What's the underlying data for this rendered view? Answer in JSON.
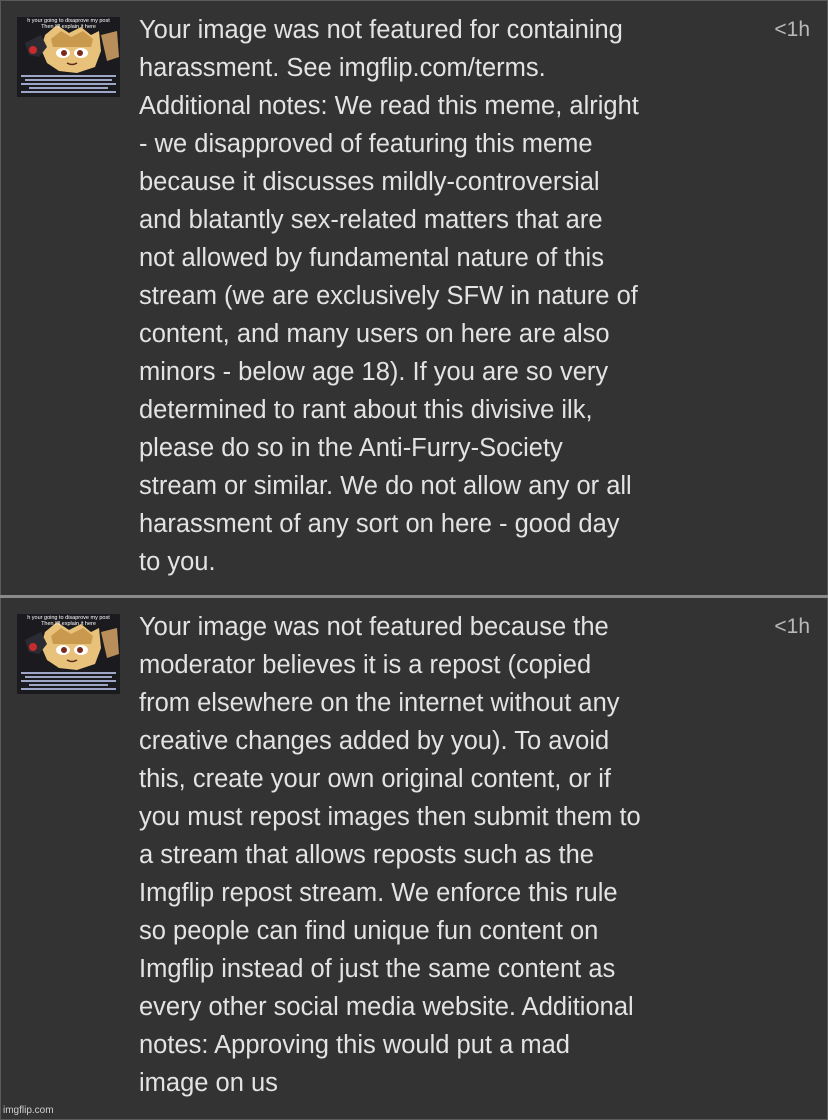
{
  "notifications": [
    {
      "thumbnail": {
        "caption_line_1": "h your going to disaprove my post",
        "caption_line_2": "Then I'll explain it here"
      },
      "message": "Your image was not featured for containing\nharassment. See imgflip.com/terms.\nAdditional notes: We read this meme, alright\n- we disapproved of featuring this meme\nbecause it discusses mildly-controversial\nand blatantly sex-related matters that are\nnot allowed by fundamental nature of this\nstream (we are exclusively SFW in nature of\ncontent, and many users on here are also\nminors - below age 18). If you are so very\ndetermined to rant about this divisive ilk,\nplease do so in the Anti-Furry-Society\nstream or similar. We do not allow any or all\nharassment of any sort on here - good day\nto you.",
      "time": "<1h"
    },
    {
      "thumbnail": {
        "caption_line_1": "h your going to disaprove my post",
        "caption_line_2": "Then I'll explain it here"
      },
      "message": "Your image was not featured because the\nmoderator believes it is a repost (copied\nfrom elsewhere on the internet without any\ncreative changes added by you). To avoid\nthis, create your own original content, or if\nyou must repost images then submit them to\na stream that allows reposts such as the\nImgflip repost stream. We enforce this rule\nso people can find unique fun content on\nImgflip instead of just the same content as\nevery other social media website. Additional\nnotes: Approving this would put a mad\nimage on us",
      "time": "<1h"
    }
  ],
  "watermark": "imgflip.com",
  "colors": {
    "background": "#333333",
    "text": "#e3e3e3",
    "timestamp": "#b9b9b9",
    "divider": "#8a8a8a"
  }
}
